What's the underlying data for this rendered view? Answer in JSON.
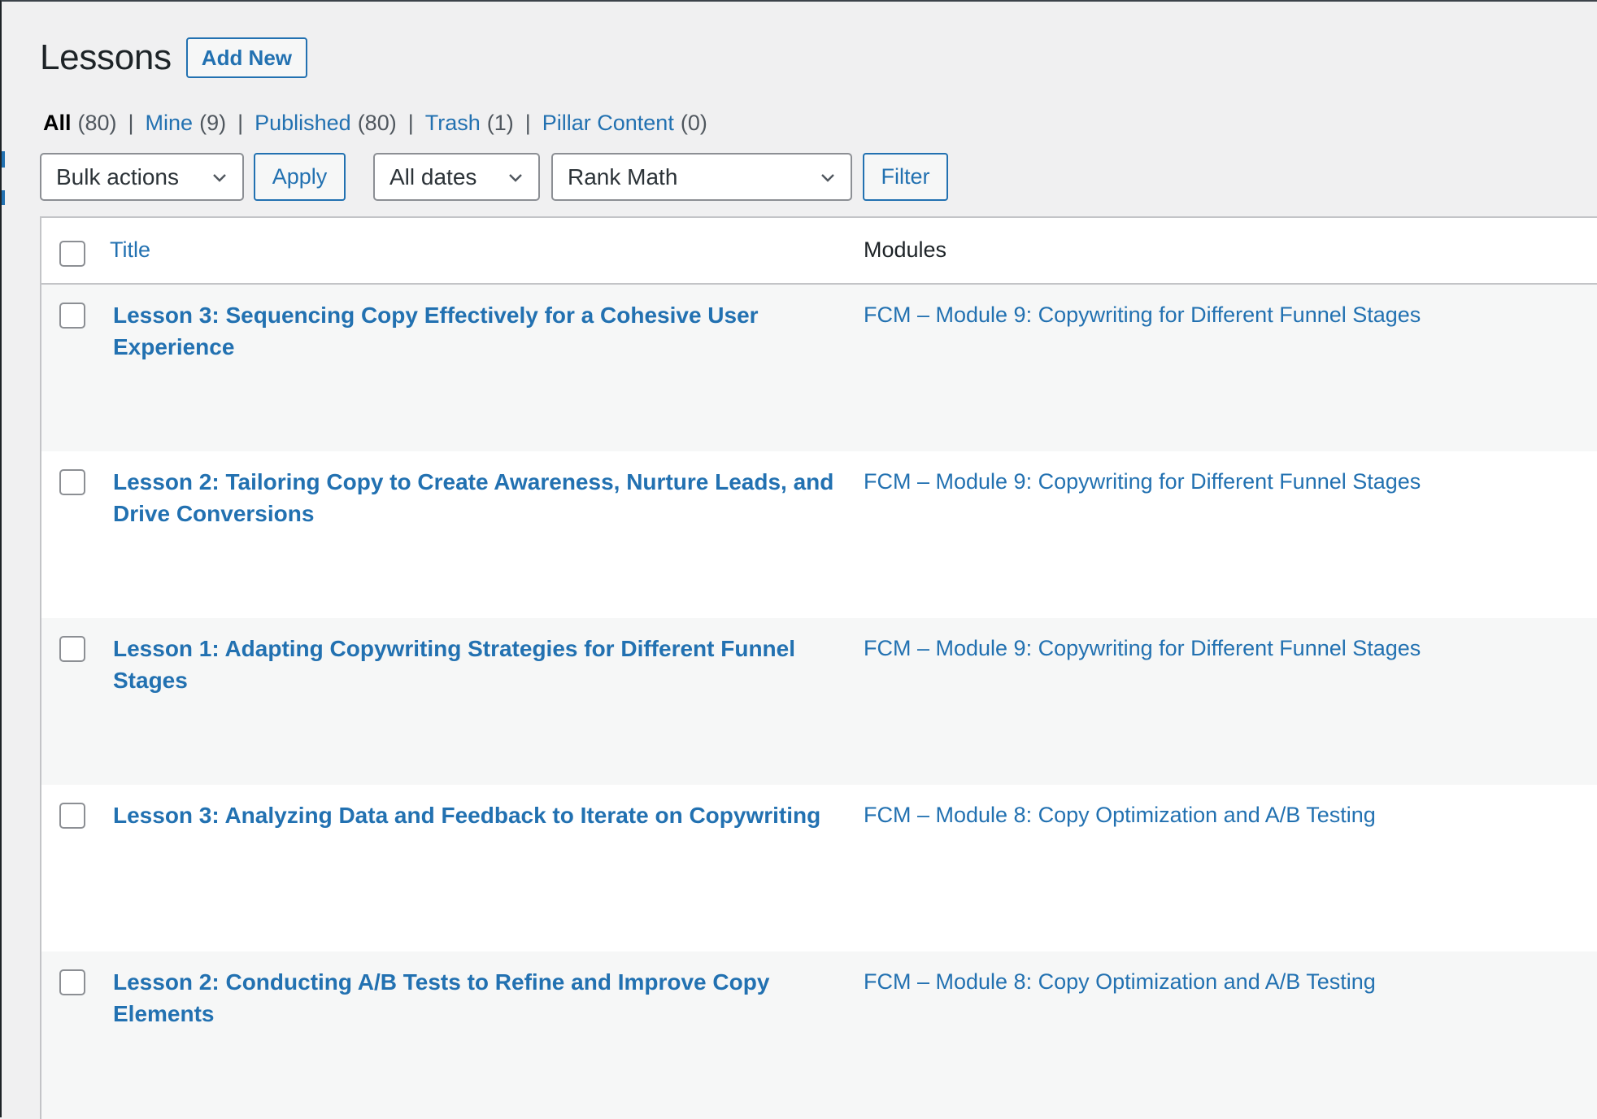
{
  "page": {
    "title": "Lessons",
    "add_new_label": "Add New"
  },
  "views": [
    {
      "label": "All",
      "count": "(80)",
      "current": true
    },
    {
      "label": "Mine",
      "count": "(9)",
      "current": false
    },
    {
      "label": "Published",
      "count": "(80)",
      "current": false
    },
    {
      "label": "Trash",
      "count": "(1)",
      "current": false
    },
    {
      "label": "Pillar Content",
      "count": "(0)",
      "current": false
    }
  ],
  "views_separator": "|",
  "toolbar": {
    "bulk_actions": "Bulk actions",
    "apply_label": "Apply",
    "dates_filter": "All dates",
    "seo_filter": "Rank Math",
    "filter_label": "Filter"
  },
  "table": {
    "columns": {
      "title": "Title",
      "modules": "Modules"
    },
    "rows": [
      {
        "title": "Lesson 3: Sequencing Copy Effectively for a Cohesive User Experience",
        "module": "FCM – Module 9: Copywriting for Different Funnel Stages",
        "checked": false
      },
      {
        "title": "Lesson 2: Tailoring Copy to Create Awareness, Nurture Leads, and Drive Conversions",
        "module": "FCM – Module 9: Copywriting for Different Funnel Stages",
        "checked": false
      },
      {
        "title": "Lesson 1: Adapting Copywriting Strategies for Different Funnel Stages",
        "module": "FCM – Module 9: Copywriting for Different Funnel Stages",
        "checked": false
      },
      {
        "title": "Lesson 3: Analyzing Data and Feedback to Iterate on Copywriting",
        "module": "FCM – Module 8: Copy Optimization and A/B Testing",
        "checked": false
      },
      {
        "title": "Lesson 2: Conducting A/B Tests to Refine and Improve Copy Elements",
        "module": "FCM – Module 8: Copy Optimization and A/B Testing",
        "checked": false
      }
    ]
  },
  "colors": {
    "link": "#2271b1",
    "background": "#f0f0f1",
    "row_alt": "#f6f7f7",
    "border": "#c3c4c7"
  }
}
